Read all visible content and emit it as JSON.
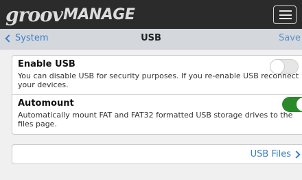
{
  "header": {
    "logo_groov": "groov",
    "logo_manage": "MANAGE"
  },
  "navbar": {
    "back_label": "System",
    "title": "USB",
    "save_label": "Save"
  },
  "settings": [
    {
      "title": "Enable USB",
      "description": "You can disable USB for security purposes. If you re-enable USB reconnect your devices.",
      "enabled": false
    },
    {
      "title": "Automount",
      "description": "Automatically mount FAT and FAT32 formatted USB storage drives to the files page.",
      "enabled": true
    }
  ],
  "files_link": {
    "label": "USB Files"
  },
  "colors": {
    "accent": "#3b7fc4",
    "toggle_on": "#2a8a2a",
    "header_bg": "#2b2b2b"
  }
}
